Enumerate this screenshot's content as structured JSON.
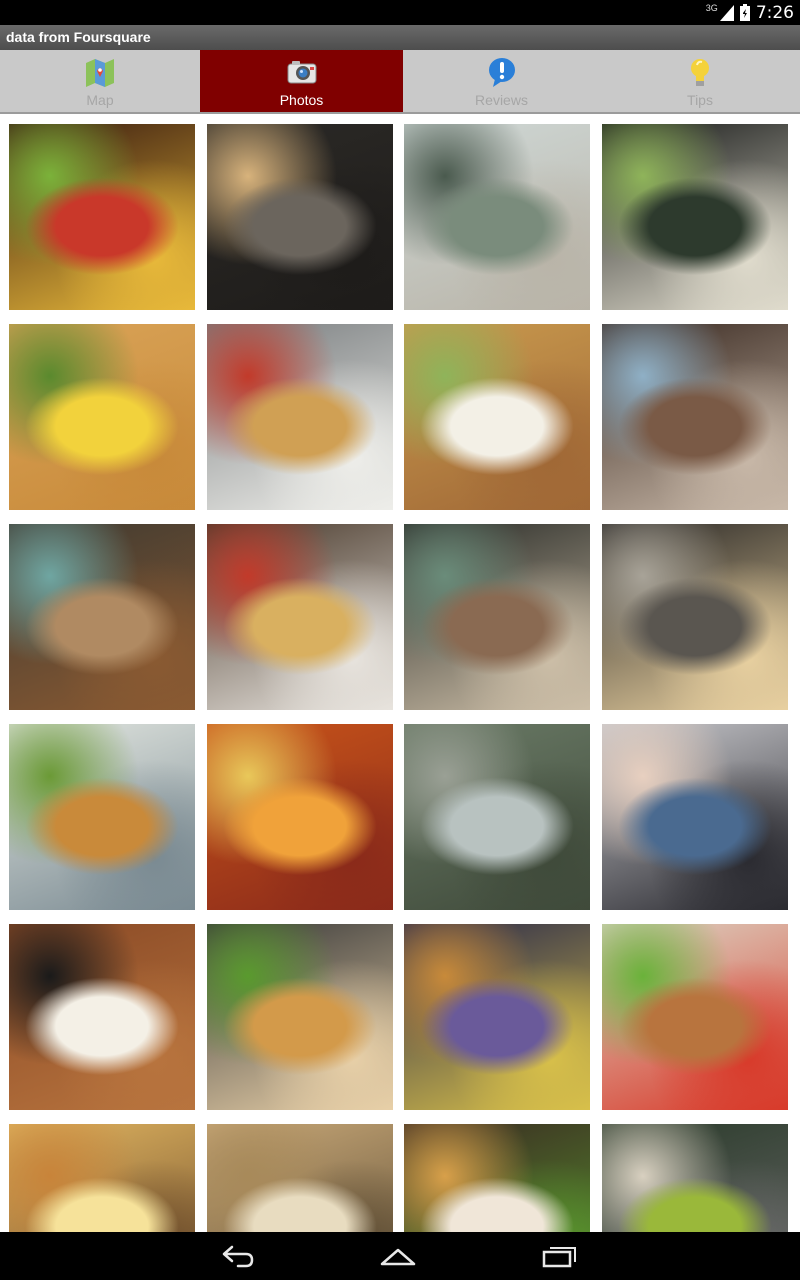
{
  "status_bar": {
    "network": "3G",
    "time": "7:26"
  },
  "app_title": "data from Foursquare",
  "tabs": [
    {
      "label": "Map",
      "icon": "map-icon",
      "active": false
    },
    {
      "label": "Photos",
      "icon": "camera-icon",
      "active": true
    },
    {
      "label": "Reviews",
      "icon": "exclamation-icon",
      "active": false
    },
    {
      "label": "Tips",
      "icon": "lightbulb-icon",
      "active": false
    }
  ],
  "photos": [
    {
      "subject": "burger closeup",
      "colors": [
        "#3a1c10",
        "#c9382a",
        "#7bb23a",
        "#e8b93a"
      ]
    },
    {
      "subject": "restaurant interior lights",
      "colors": [
        "#2b2926",
        "#6b655d",
        "#d8b37c",
        "#1e1c1a"
      ]
    },
    {
      "subject": "glass atrium hallway",
      "colors": [
        "#cfd8d6",
        "#7a8c7c",
        "#4a5a4e",
        "#b9b4a8"
      ]
    },
    {
      "subject": "menu board",
      "colors": [
        "#1a1c1b",
        "#2d3a2d",
        "#8fb45a",
        "#e0dccd"
      ]
    },
    {
      "subject": "burger with fries",
      "colors": [
        "#d9a357",
        "#f2d23c",
        "#5a8a2e",
        "#c88a3a"
      ]
    },
    {
      "subject": "tray with fries and burger",
      "colors": [
        "#7a7e80",
        "#d0a054",
        "#c23a2a",
        "#eeeeea"
      ]
    },
    {
      "subject": "burger shake fries",
      "colors": [
        "#c99a4e",
        "#f3f0e6",
        "#8fb45a",
        "#a06836"
      ]
    },
    {
      "subject": "selfie couple",
      "colors": [
        "#3a2a22",
        "#7a5a46",
        "#8fb0c6",
        "#c8b8a8"
      ]
    },
    {
      "subject": "boy at table",
      "colors": [
        "#3f3a31",
        "#b08a62",
        "#6fa6a2",
        "#8a5a32"
      ]
    },
    {
      "subject": "tray hot dog fries",
      "colors": [
        "#4a3a2c",
        "#d9b060",
        "#c23a2a",
        "#e8e4de"
      ]
    },
    {
      "subject": "group at table",
      "colors": [
        "#2a2c28",
        "#8a6a52",
        "#6a8c7a",
        "#cdbfa8"
      ]
    },
    {
      "subject": "interior sign lights",
      "colors": [
        "#2a2826",
        "#5a5650",
        "#a8a398",
        "#e8d0a0"
      ]
    },
    {
      "subject": "two burgers on tray",
      "colors": [
        "#e2e6e0",
        "#c98a3a",
        "#6b9a36",
        "#7a8a92"
      ]
    },
    {
      "subject": "fries shake crinkle fries",
      "colors": [
        "#c8541a",
        "#f0a23a",
        "#e9c85a",
        "#8a2a1a"
      ]
    },
    {
      "subject": "street storefront",
      "colors": [
        "#6a7a66",
        "#b8c2c0",
        "#9aa095",
        "#3f4a3a"
      ]
    },
    {
      "subject": "baby in stroller",
      "colors": [
        "#c8c8cc",
        "#4a6a90",
        "#e8d0c0",
        "#2a2a30"
      ]
    },
    {
      "subject": "chocolate bar",
      "colors": [
        "#8a4a26",
        "#f4f0e6",
        "#1a1a1a",
        "#b8743e"
      ]
    },
    {
      "subject": "stacked burgers and fries",
      "colors": [
        "#3a3a3a",
        "#d39a4a",
        "#5a9a2e",
        "#e8d0a8"
      ]
    },
    {
      "subject": "tray under purple light",
      "colors": [
        "#2a2a4a",
        "#6a5a9a",
        "#c88a3a",
        "#d8c04a"
      ]
    },
    {
      "subject": "chicken sandwich",
      "colors": [
        "#dcd4c4",
        "#b8743e",
        "#6ab23a",
        "#d83a2a"
      ]
    },
    {
      "subject": "fries and burger",
      "colors": [
        "#e0b460",
        "#f6e29a",
        "#c8843a",
        "#6a4a2a"
      ]
    },
    {
      "subject": "burger in box",
      "colors": [
        "#c8a878",
        "#e8dcc0",
        "#a88a5a",
        "#5a4a32"
      ]
    },
    {
      "subject": "tray with shake and fries",
      "colors": [
        "#3a2a22",
        "#f0e6d8",
        "#d8a04a",
        "#5a9a2e"
      ]
    },
    {
      "subject": "phone buzzer",
      "colors": [
        "#2a3a2a",
        "#9ab83a",
        "#d8d0c0",
        "#6a6a6a"
      ]
    }
  ]
}
